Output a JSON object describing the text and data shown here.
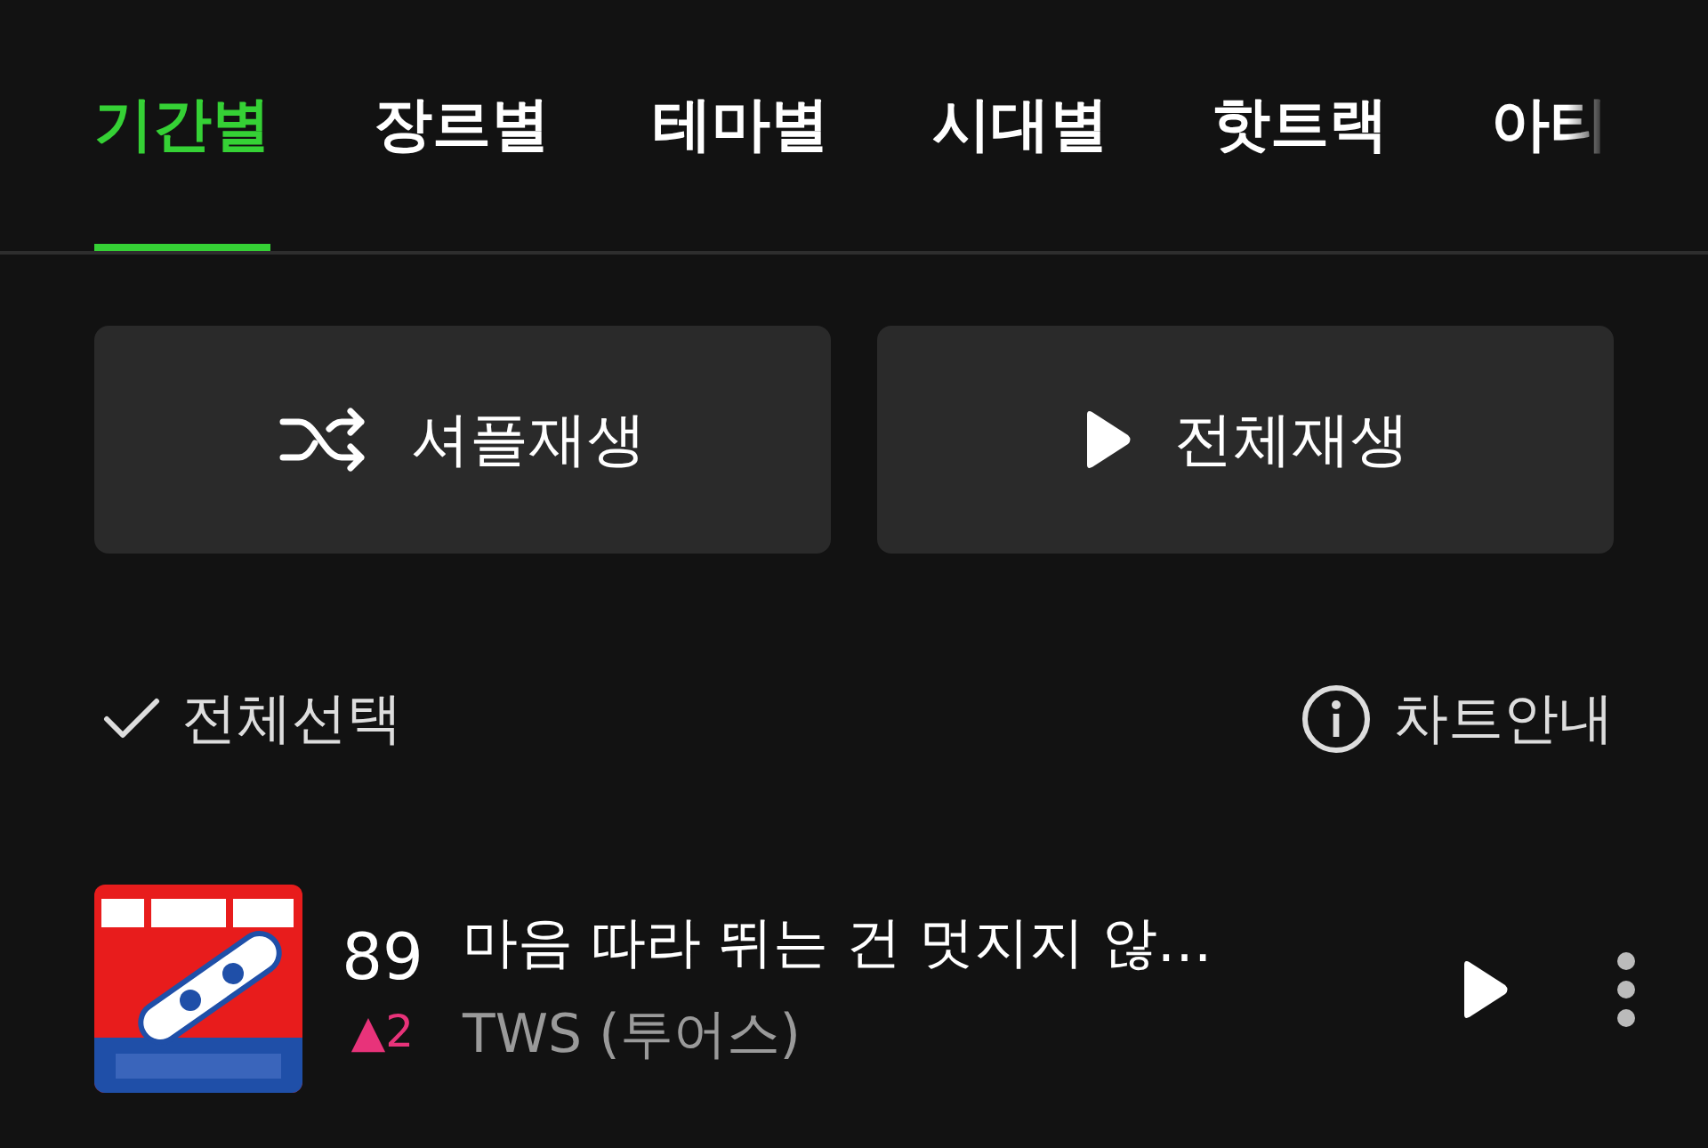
{
  "tabs": [
    {
      "label": "기간별",
      "selected": true
    },
    {
      "label": "장르별",
      "selected": false
    },
    {
      "label": "테마별",
      "selected": false
    },
    {
      "label": "시대별",
      "selected": false
    },
    {
      "label": "핫트랙",
      "selected": false
    },
    {
      "label": "아티",
      "selected": false
    }
  ],
  "buttons": [
    {
      "kind": "shuffle",
      "label": "셔플재생"
    },
    {
      "kind": "play",
      "label": "전체재생"
    }
  ],
  "select_all": {
    "label": "전체선택"
  },
  "chart_info": {
    "label": "차트안내"
  },
  "songs": [
    {
      "rank": "89",
      "change": "▲2",
      "color": "#e8337a",
      "title": "마음 따라 뛰는 건 멋지지 않…",
      "artist": "TWS (투어스)"
    }
  ]
}
